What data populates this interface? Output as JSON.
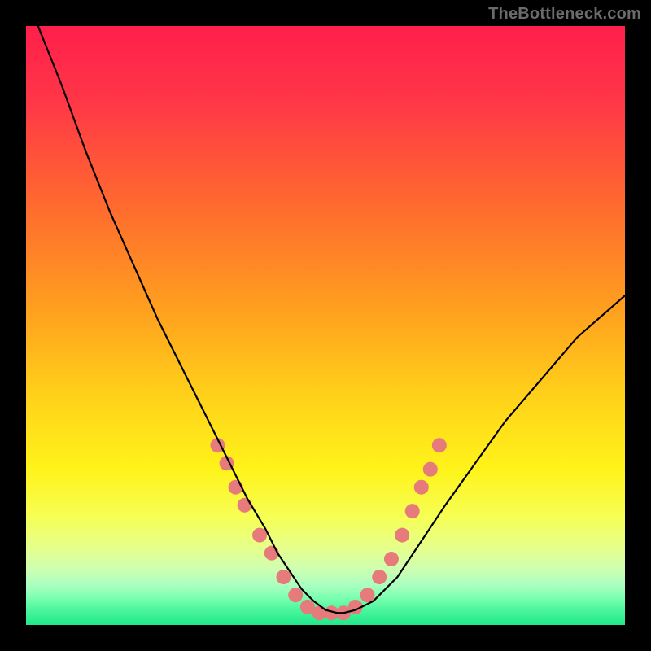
{
  "watermark": "TheBottleneck.com",
  "chart_data": {
    "type": "line",
    "title": "",
    "xlabel": "",
    "ylabel": "",
    "xlim": [
      0,
      100
    ],
    "ylim": [
      0,
      100
    ],
    "grid": false,
    "legend": false,
    "gradient_stops": [
      {
        "offset": 0.0,
        "color": "#ff1f4b"
      },
      {
        "offset": 0.12,
        "color": "#ff3548"
      },
      {
        "offset": 0.3,
        "color": "#ff6a2e"
      },
      {
        "offset": 0.48,
        "color": "#ffa21e"
      },
      {
        "offset": 0.62,
        "color": "#ffd21a"
      },
      {
        "offset": 0.74,
        "color": "#fff31a"
      },
      {
        "offset": 0.82,
        "color": "#f6ff55"
      },
      {
        "offset": 0.87,
        "color": "#e6ff8a"
      },
      {
        "offset": 0.905,
        "color": "#d0ffb0"
      },
      {
        "offset": 0.935,
        "color": "#a8ffc0"
      },
      {
        "offset": 0.955,
        "color": "#7affb0"
      },
      {
        "offset": 0.975,
        "color": "#4cf59d"
      },
      {
        "offset": 1.0,
        "color": "#1fe98a"
      }
    ],
    "series": [
      {
        "name": "bottleneck-curve",
        "color": "#000000",
        "x": [
          2,
          6,
          10,
          14,
          18,
          22,
          26,
          30,
          34,
          37,
          40,
          42,
          44,
          46,
          48,
          50,
          52,
          53,
          55,
          58,
          62,
          66,
          70,
          75,
          80,
          86,
          92,
          100
        ],
        "y": [
          100,
          90,
          79,
          69,
          60,
          51,
          43,
          35,
          27,
          21,
          16,
          12,
          9,
          6,
          4,
          2.5,
          2,
          2,
          2.5,
          4,
          8,
          14,
          20,
          27,
          34,
          41,
          48,
          55
        ]
      }
    ],
    "markers": {
      "name": "highlight-beads",
      "color": "#e77a7a",
      "radius_px": 9,
      "points": [
        {
          "x": 32,
          "y": 30
        },
        {
          "x": 33.5,
          "y": 27
        },
        {
          "x": 35,
          "y": 23
        },
        {
          "x": 36.5,
          "y": 20
        },
        {
          "x": 39,
          "y": 15
        },
        {
          "x": 41,
          "y": 12
        },
        {
          "x": 43,
          "y": 8
        },
        {
          "x": 45,
          "y": 5
        },
        {
          "x": 47,
          "y": 3
        },
        {
          "x": 49,
          "y": 2
        },
        {
          "x": 51,
          "y": 2
        },
        {
          "x": 53,
          "y": 2
        },
        {
          "x": 55,
          "y": 3
        },
        {
          "x": 57,
          "y": 5
        },
        {
          "x": 59,
          "y": 8
        },
        {
          "x": 61,
          "y": 11
        },
        {
          "x": 62.8,
          "y": 15
        },
        {
          "x": 64.5,
          "y": 19
        },
        {
          "x": 66,
          "y": 23
        },
        {
          "x": 67.5,
          "y": 26
        },
        {
          "x": 69,
          "y": 30
        }
      ]
    }
  }
}
